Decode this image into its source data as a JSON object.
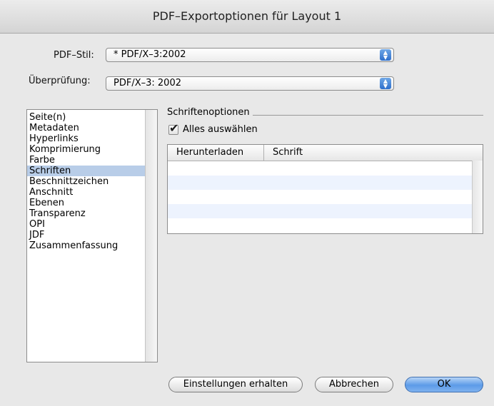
{
  "window": {
    "title": "PDF–Exportoptionen für Layout 1"
  },
  "form": {
    "pdf_style": {
      "label": "PDF–Stil:",
      "value": "* PDF/X–3:2002"
    },
    "check": {
      "label": "Überprüfung:",
      "value": "PDF/X–3: 2002"
    }
  },
  "sidebar": {
    "items": [
      {
        "label": "Seite(n)",
        "selected": false
      },
      {
        "label": "Metadaten",
        "selected": false
      },
      {
        "label": "Hyperlinks",
        "selected": false
      },
      {
        "label": "Komprimierung",
        "selected": false
      },
      {
        "label": "Farbe",
        "selected": false
      },
      {
        "label": "Schriften",
        "selected": true
      },
      {
        "label": "Beschnittzeichen",
        "selected": false
      },
      {
        "label": "Anschnitt",
        "selected": false
      },
      {
        "label": "Ebenen",
        "selected": false
      },
      {
        "label": "Transparenz",
        "selected": false
      },
      {
        "label": "OPI",
        "selected": false
      },
      {
        "label": "JDF",
        "selected": false
      },
      {
        "label": "Zusammenfassung",
        "selected": false
      }
    ]
  },
  "fonts_panel": {
    "group_title": "Schriftenoptionen",
    "select_all": {
      "label": "Alles auswählen",
      "checked": true
    },
    "table": {
      "columns": [
        "Herunterladen",
        "Schrift"
      ]
    }
  },
  "buttons": {
    "keep_settings": "Einstellungen erhalten",
    "cancel": "Abbrechen",
    "ok": "OK"
  },
  "colors": {
    "selection": "#b8cde8",
    "accent": "#5c9be8"
  },
  "icons": {
    "popup_arrow": "up-down-arrows-icon",
    "checkbox": "checkmark-icon"
  }
}
